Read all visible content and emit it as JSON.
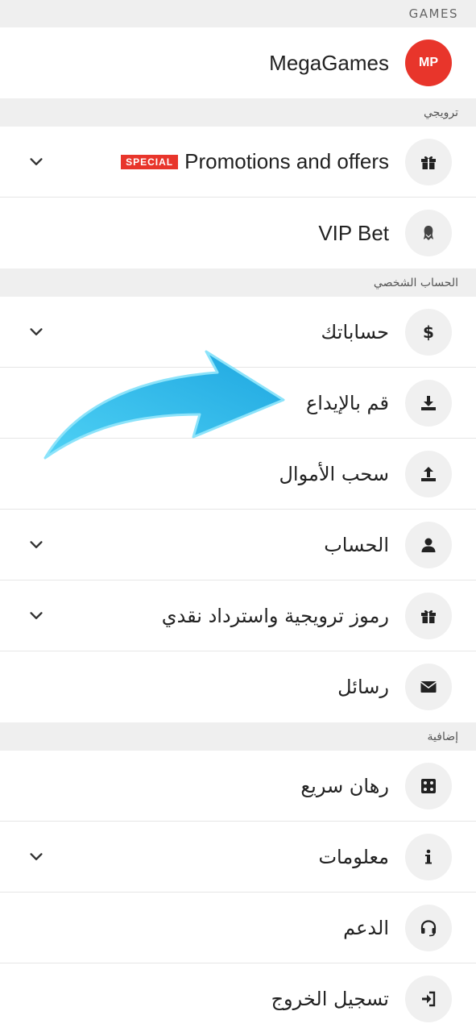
{
  "sections": {
    "games": "GAMES",
    "promo": "ترويجي",
    "personal": "الحساب الشخصي",
    "extra": "إضافية"
  },
  "brand": {
    "logo_text": "MP",
    "name": "MegaGames"
  },
  "promo_items": [
    {
      "label": "Promotions and offers",
      "badge": "SPECIAL",
      "icon": "gift-icon",
      "expandable": true
    },
    {
      "label": "VIP Bet",
      "icon": "vip-icon",
      "expandable": false
    }
  ],
  "personal_items": [
    {
      "label": "حساباتك",
      "icon": "dollar-icon",
      "expandable": true
    },
    {
      "label": "قم بالإيداع",
      "icon": "deposit-icon",
      "expandable": false
    },
    {
      "label": "سحب الأموال",
      "icon": "withdraw-icon",
      "expandable": false
    },
    {
      "label": "الحساب",
      "icon": "user-icon",
      "expandable": true
    },
    {
      "label": "رموز ترويجية واسترداد نقدي",
      "icon": "gift-icon",
      "expandable": true
    },
    {
      "label": "رسائل",
      "icon": "envelope-icon",
      "expandable": false
    }
  ],
  "extra_items": [
    {
      "label": "رهان سريع",
      "icon": "dice-icon",
      "expandable": false
    },
    {
      "label": "معلومات",
      "icon": "info-icon",
      "expandable": true
    },
    {
      "label": "الدعم",
      "icon": "headset-icon",
      "expandable": false
    },
    {
      "label": "تسجيل الخروج",
      "icon": "logout-icon",
      "expandable": false
    }
  ],
  "colors": {
    "accent": "#e8352b",
    "arrow": "#29b6e6",
    "section_bg": "#efefef",
    "icon_bg": "#f0f0f0"
  }
}
